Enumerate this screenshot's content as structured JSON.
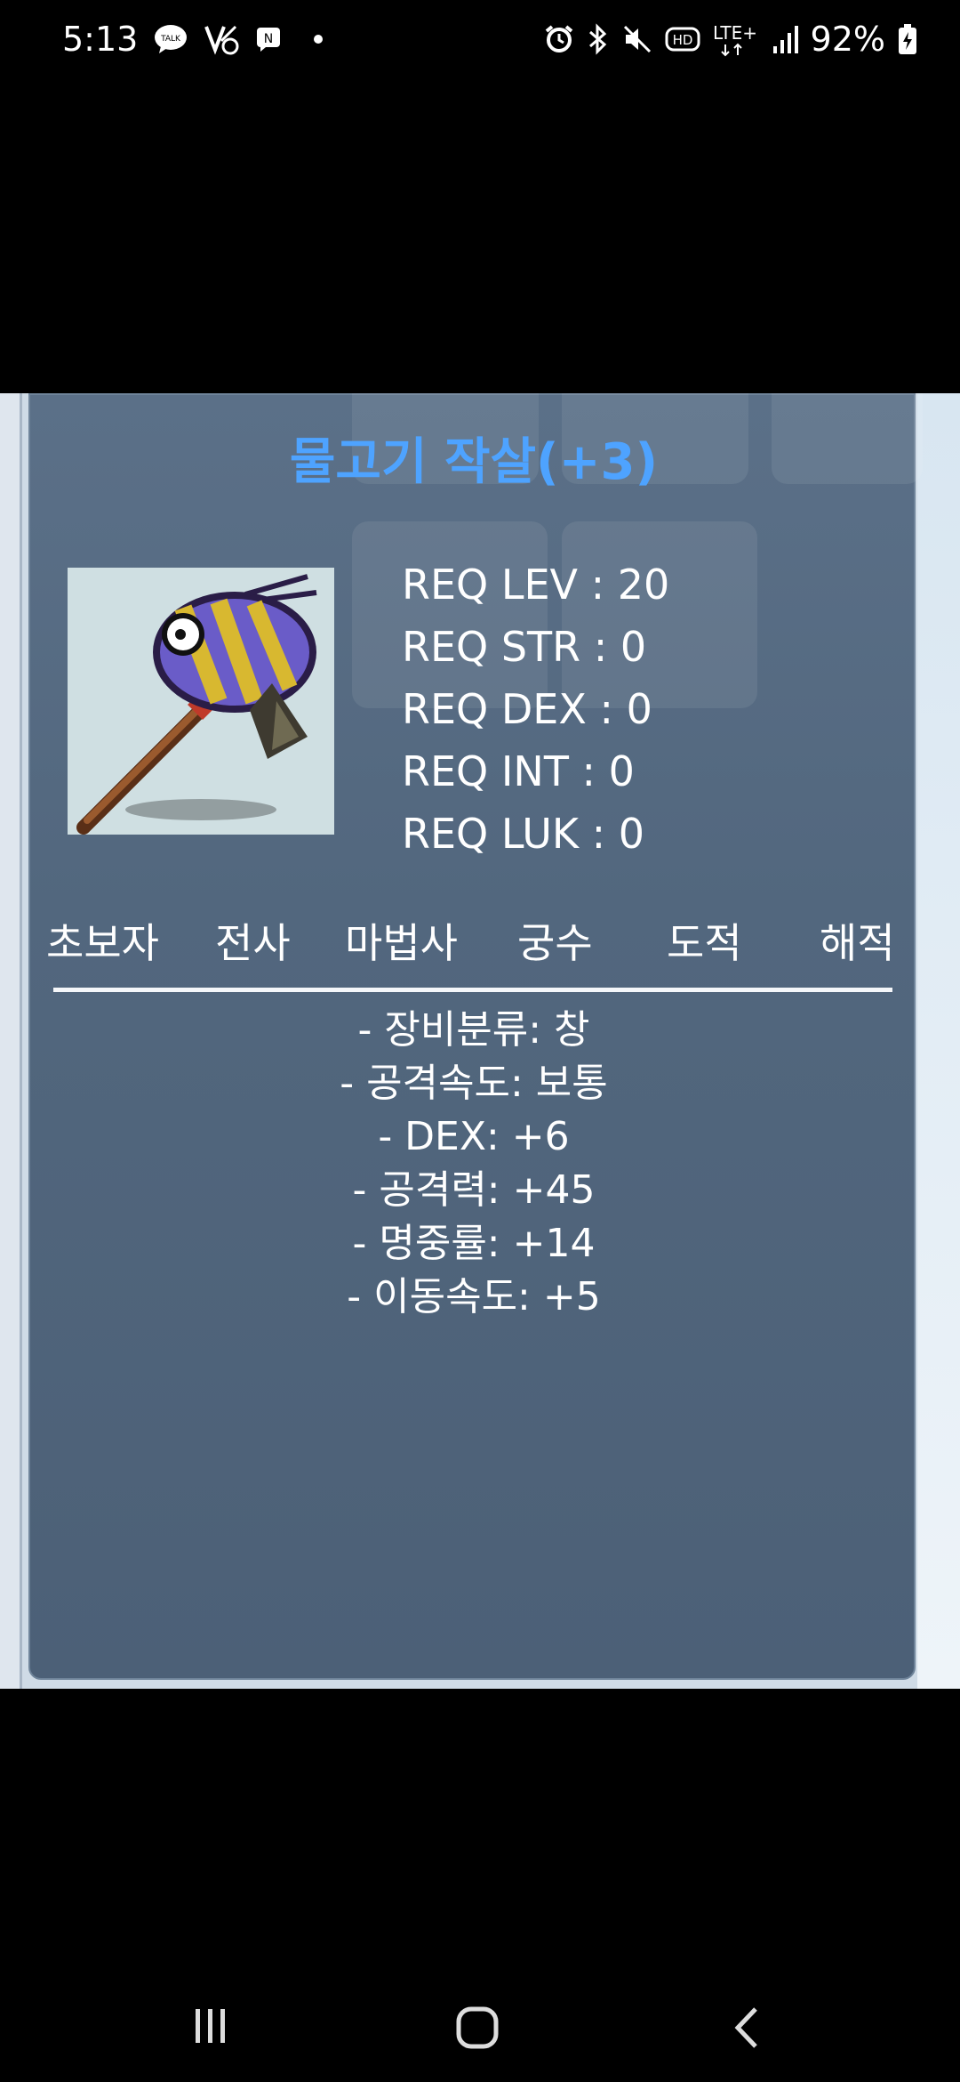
{
  "status_bar": {
    "time": "5:13",
    "battery": "92%",
    "notification_icons": [
      "talk-icon",
      "volte-icon",
      "message-icon",
      "dot-icon"
    ],
    "system_icons": [
      "alarm-icon",
      "bluetooth-icon",
      "mute-icon",
      "hd-icon",
      "lte-icon",
      "signal-icon",
      "battery-icon"
    ]
  },
  "item": {
    "name": "물고기 작살(+3)",
    "requirements": [
      "REQ LEV : 20",
      "REQ STR : 0",
      "REQ DEX : 0",
      "REQ INT : 0",
      "REQ LUK : 0"
    ],
    "jobs": [
      "초보자",
      "전사",
      "마법사",
      "궁수",
      "도적",
      "해적"
    ],
    "stats": [
      "- 장비분류: 창",
      "- 공격속도: 보통",
      "- DEX: +6",
      "- 공격력: +45",
      "- 명중률: +14",
      "- 이동속도: +5"
    ]
  },
  "colors": {
    "title": "#4ea3ff",
    "panel": "#52677e",
    "background": "#000000"
  },
  "nav_bar": {
    "icons": [
      "recent-apps-icon",
      "home-icon",
      "back-icon"
    ]
  }
}
